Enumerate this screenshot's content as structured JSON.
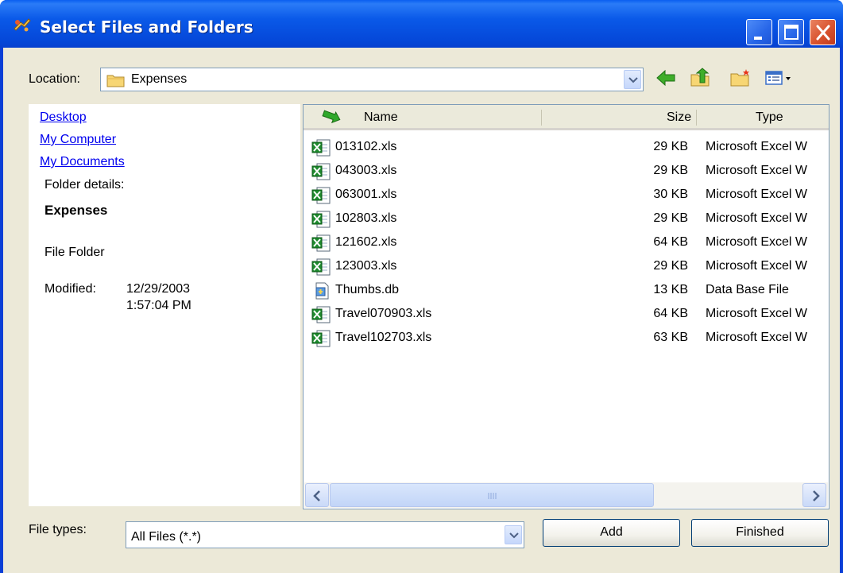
{
  "window": {
    "title": "Select Files and Folders"
  },
  "location": {
    "label": "Location:",
    "value": "Expenses"
  },
  "nav": {
    "links": [
      "Desktop",
      "My Computer",
      "My Documents"
    ],
    "details_label": "Folder details:",
    "folder_name": "Expenses",
    "folder_type": "File Folder",
    "modified_label": "Modified:",
    "modified_date": "12/29/2003",
    "modified_time": "1:57:04 PM"
  },
  "columns": {
    "name": "Name",
    "size": "Size",
    "type": "Type"
  },
  "files": [
    {
      "name": "013102.xls",
      "size": "29 KB",
      "type": "Microsoft Excel W",
      "icon": "excel-file-icon"
    },
    {
      "name": "043003.xls",
      "size": "29 KB",
      "type": "Microsoft Excel W",
      "icon": "excel-file-icon"
    },
    {
      "name": "063001.xls",
      "size": "30 KB",
      "type": "Microsoft Excel W",
      "icon": "excel-file-icon"
    },
    {
      "name": "102803.xls",
      "size": "29 KB",
      "type": "Microsoft Excel W",
      "icon": "excel-file-icon"
    },
    {
      "name": "121602.xls",
      "size": "64 KB",
      "type": "Microsoft Excel W",
      "icon": "excel-file-icon"
    },
    {
      "name": "123003.xls",
      "size": "29 KB",
      "type": "Microsoft Excel W",
      "icon": "excel-file-icon"
    },
    {
      "name": "Thumbs.db",
      "size": "13 KB",
      "type": "Data Base File",
      "icon": "database-file-icon"
    },
    {
      "name": "Travel070903.xls",
      "size": "64 KB",
      "type": "Microsoft Excel W",
      "icon": "excel-file-icon"
    },
    {
      "name": "Travel102703.xls",
      "size": "63 KB",
      "type": "Microsoft Excel W",
      "icon": "excel-file-icon"
    }
  ],
  "filetypes": {
    "label": "File types:",
    "value": "All Files (*.*)"
  },
  "buttons": {
    "add": "Add",
    "finished": "Finished"
  },
  "colors": {
    "title_bar": "#0a59e8",
    "dialog_bg": "#ece9d8",
    "link": "#0000ee",
    "close_button": "#d9532e"
  }
}
